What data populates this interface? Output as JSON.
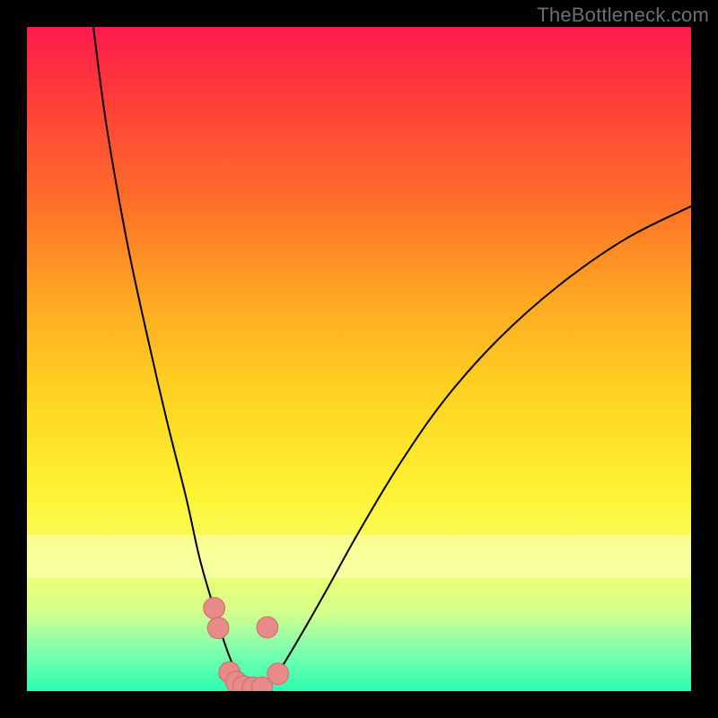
{
  "watermark": "TheBottleneck.com",
  "colors": {
    "frame": "#000000",
    "curve_stroke": "#000000",
    "marker_fill": "#e88a88",
    "marker_stroke": "#cf6f6d",
    "gradient_top": "#ff1a4d",
    "gradient_bottom": "#2bffad"
  },
  "chart_data": {
    "type": "line",
    "title": "",
    "xlabel": "",
    "ylabel": "",
    "xlim": [
      0,
      100
    ],
    "ylim": [
      0,
      100
    ],
    "grid": false,
    "legend": false,
    "series": [
      {
        "name": "left-curve",
        "x": [
          10,
          12,
          15,
          18,
          21,
          24,
          26,
          28,
          29.5,
          31,
          32.5,
          33.5
        ],
        "y": [
          100,
          85,
          68,
          54,
          41,
          29,
          20,
          13,
          8,
          4,
          1.5,
          0
        ]
      },
      {
        "name": "right-curve",
        "x": [
          36,
          38,
          41,
          45,
          50,
          56,
          63,
          71,
          80,
          90,
          100
        ],
        "y": [
          0,
          3,
          8,
          15,
          24,
          34,
          44,
          53,
          61,
          68,
          73
        ]
      }
    ],
    "markers": [
      {
        "x": 28.2,
        "y": 12.5,
        "r": 1.6
      },
      {
        "x": 28.8,
        "y": 9.5,
        "r": 1.6
      },
      {
        "x": 30.5,
        "y": 2.8,
        "r": 1.6
      },
      {
        "x": 31.5,
        "y": 1.4,
        "r": 1.6
      },
      {
        "x": 32.6,
        "y": 0.7,
        "r": 1.6
      },
      {
        "x": 34.0,
        "y": 0.5,
        "r": 1.6
      },
      {
        "x": 35.4,
        "y": 0.5,
        "r": 1.6
      },
      {
        "x": 37.8,
        "y": 2.6,
        "r": 1.6
      },
      {
        "x": 36.2,
        "y": 9.6,
        "r": 1.6
      }
    ],
    "annotations": []
  }
}
